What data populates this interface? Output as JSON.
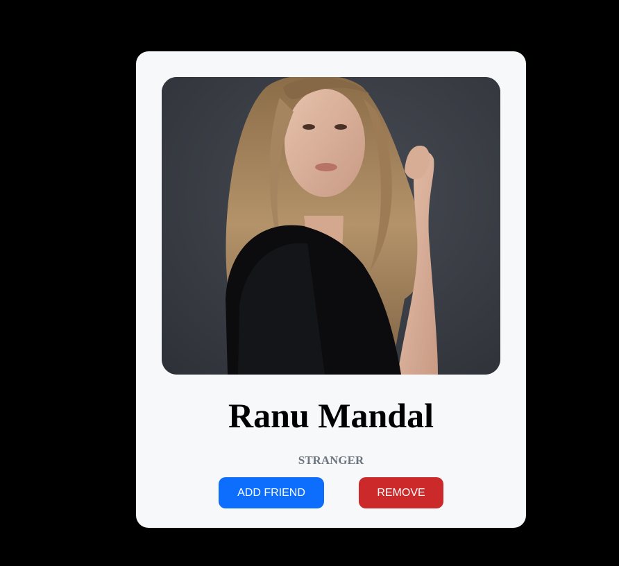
{
  "profile": {
    "name": "Ranu Mandal",
    "status": "STRANGER",
    "photo_icon": "person-portrait"
  },
  "actions": {
    "add_friend_label": "ADD FRIEND",
    "remove_label": "REMOVE"
  },
  "colors": {
    "page_background": "#000000",
    "card_background": "#f7f8fa",
    "add_button": "#0d6efd",
    "remove_button": "#cc2a2a",
    "status_text": "#6c757d"
  }
}
